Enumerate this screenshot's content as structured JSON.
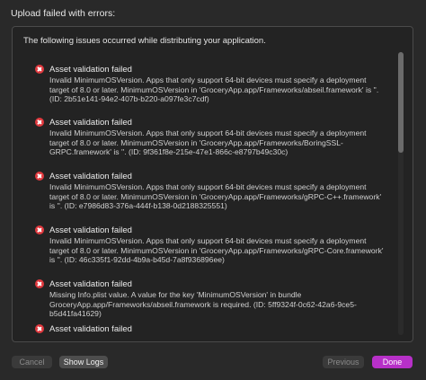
{
  "dialog": {
    "title": "Upload failed with errors:",
    "intro": "The following issues occurred while distributing your application."
  },
  "issues": [
    {
      "title": "Asset validation failed",
      "detail": "Invalid MinimumOSVersion. Apps that only support 64-bit devices must specify a deployment target of 8.0 or later. MinimumOSVersion in 'GroceryApp.app/Frameworks/abseil.framework' is ''. (ID: 2b51e141-94e2-407b-b220-a097fe3c7cdf)"
    },
    {
      "title": "Asset validation failed",
      "detail": "Invalid MinimumOSVersion. Apps that only support 64-bit devices must specify a deployment target of 8.0 or later. MinimumOSVersion in 'GroceryApp.app/Frameworks/BoringSSL-GRPC.framework' is ''. (ID: 9f361f8e-215e-47e1-866c-e8797b49c30c)"
    },
    {
      "title": "Asset validation failed",
      "detail": "Invalid MinimumOSVersion. Apps that only support 64-bit devices must specify a deployment target of 8.0 or later. MinimumOSVersion in 'GroceryApp.app/Frameworks/gRPC-C++.framework' is ''. (ID: e7986d83-376a-444f-b138-0d2188325551)"
    },
    {
      "title": "Asset validation failed",
      "detail": "Invalid MinimumOSVersion. Apps that only support 64-bit devices must specify a deployment target of 8.0 or later. MinimumOSVersion in 'GroceryApp.app/Frameworks/gRPC-Core.framework' is ''. (ID: 46c335f1-92dd-4b9a-b45d-7a8f936896ee)"
    },
    {
      "title": "Asset validation failed",
      "detail": "Missing Info.plist value. A value for the key 'MinimumOSVersion' in bundle GroceryApp.app/Frameworks/abseil.framework is required. (ID: 5ff9324f-0c62-42a6-9ce5-b5d41fa41629)"
    },
    {
      "title": "Asset validation failed",
      "detail": ""
    }
  ],
  "buttons": {
    "cancel": "Cancel",
    "show_logs": "Show Logs",
    "previous": "Previous",
    "done": "Done"
  },
  "colors": {
    "error": "#e0393e",
    "accent": "#b730c8"
  }
}
